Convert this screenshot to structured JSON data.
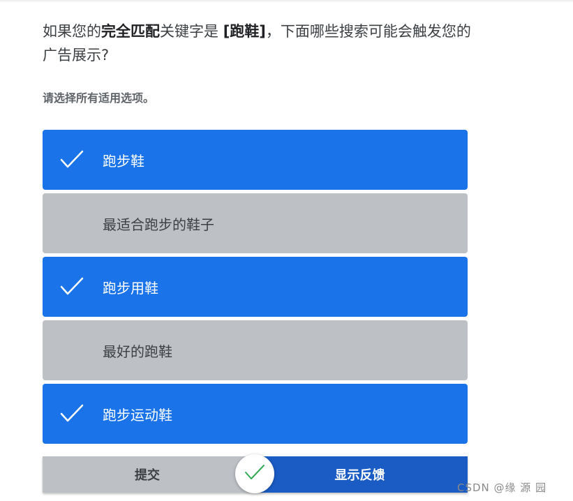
{
  "question": {
    "prefix": "如果您的",
    "match_type": "完全匹配",
    "middle": "关键字是 ",
    "keyword": "[跑鞋]",
    "suffix": "，下面哪些搜索可能会触发您的广告展示?"
  },
  "instruction": "请选择所有适用选项。",
  "options": [
    {
      "label": "跑步鞋",
      "selected": true
    },
    {
      "label": "最适合跑步的鞋子",
      "selected": false
    },
    {
      "label": "跑步用鞋",
      "selected": true
    },
    {
      "label": "最好的跑鞋",
      "selected": false
    },
    {
      "label": "跑步运动鞋",
      "selected": true
    }
  ],
  "buttons": {
    "submit_label": "提交",
    "feedback_label": "显示反馈"
  },
  "result_icon": "checkmark-icon",
  "watermark": "CSDN @缘 源 园",
  "colors": {
    "selected": "#1a73e8",
    "unselected": "#bdc1c6",
    "feedback_button": "#1a5bc4",
    "result_check": "#34a853"
  }
}
